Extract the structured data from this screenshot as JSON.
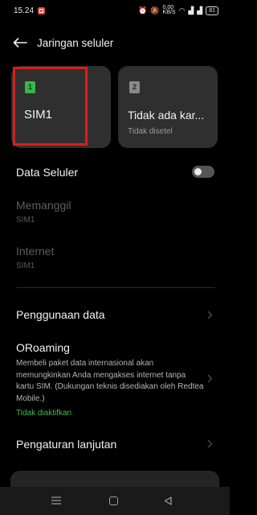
{
  "status_bar": {
    "time": "15.24",
    "network_speed": "0,00\nKB/S",
    "battery": "81"
  },
  "header": {
    "title": "Jaringan seluler"
  },
  "sim_cards": [
    {
      "badge": "1",
      "name": "SIM1",
      "sub": ""
    },
    {
      "badge": "2",
      "name": "Tidak ada kar...",
      "sub": "Tidak disetel"
    }
  ],
  "settings": {
    "data_seluler": "Data Seluler",
    "memanggil": {
      "label": "Memanggil",
      "value": "SIM1"
    },
    "internet": {
      "label": "Internet",
      "value": "SIM1"
    },
    "penggunaan_data": "Penggunaan data",
    "oroaming": {
      "label": "ORoaming",
      "description": "Membeli paket data internasional akan memungkinkan Anda mengakses internet tanpa kartu SIM. (Dukungan teknis disediakan oleh Redtea Mobile.)",
      "status": "Tidak diaktifkan"
    },
    "pengaturan_lanjutan": "Pengaturan lanjutan"
  },
  "colors": {
    "background": "#000000",
    "card": "#2f2f2f",
    "sim1_badge": "#39b54a",
    "highlight": "#e21a1a",
    "status_green": "#3fbf4c"
  },
  "data_seluler_enabled": false
}
